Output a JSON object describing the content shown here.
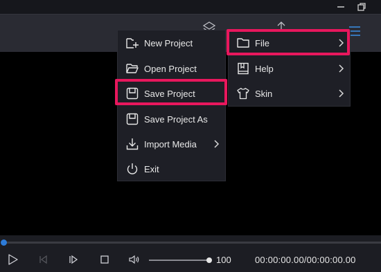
{
  "file_submenu": [
    {
      "label": "New Project",
      "icon": "new-project-icon",
      "has_submenu": false
    },
    {
      "label": "Open Project",
      "icon": "folder-open-icon",
      "has_submenu": false
    },
    {
      "label": "Save Project",
      "icon": "save-icon",
      "has_submenu": false,
      "highlighted": true
    },
    {
      "label": "Save Project As",
      "icon": "save-as-icon",
      "has_submenu": false
    },
    {
      "label": "Import Media",
      "icon": "import-icon",
      "has_submenu": true
    },
    {
      "label": "Exit",
      "icon": "power-icon",
      "has_submenu": false
    }
  ],
  "main_menu": [
    {
      "label": "File",
      "icon": "folder-icon",
      "has_submenu": true,
      "highlighted": true
    },
    {
      "label": "Help",
      "icon": "help-book-icon",
      "has_submenu": true
    },
    {
      "label": "Skin",
      "icon": "shirt-icon",
      "has_submenu": true
    }
  ],
  "playback": {
    "volume": "100",
    "time": "00:00:00.00/00:00:00.00",
    "seek_progress": 0
  },
  "colors": {
    "highlight": "#e8175d",
    "accent": "#2d7bd8",
    "menu_bg": "#1e1f26"
  }
}
